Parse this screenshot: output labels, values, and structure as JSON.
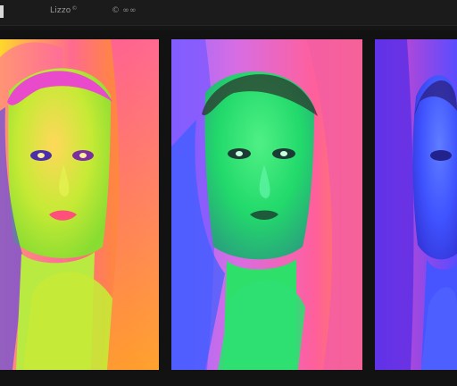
{
  "toolbar": {
    "tab_primary": "Lizzo",
    "tab_primary_mark": "©",
    "tab_secondary": "© ∞∞"
  },
  "gallery": {
    "panels": [
      {
        "name": "panel-1",
        "palette": "yellow-orange"
      },
      {
        "name": "panel-2",
        "palette": "green-magenta"
      },
      {
        "name": "panel-3",
        "palette": "blue-violet"
      }
    ],
    "colors": {
      "yellow_green": "#b7e23a",
      "orange": "#ff9a1e",
      "magenta": "#e0428f",
      "green": "#3fdd6a",
      "blue": "#3f58ff",
      "violet": "#6b3cf0"
    }
  }
}
